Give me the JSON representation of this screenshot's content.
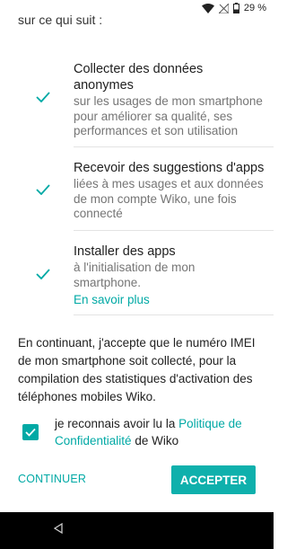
{
  "status_bar": {
    "battery_percent": "29 %",
    "icons": [
      "wifi-icon",
      "no-signal-icon",
      "battery-icon"
    ]
  },
  "intro": "sur ce qui suit :",
  "features": [
    {
      "title": "Collecter des données anonymes",
      "description": "sur les usages de mon smartphone pour améliorer sa qualité, ses performances et son utilisation",
      "checked": true
    },
    {
      "title": "Recevoir des suggestions d'apps",
      "description": "liées à mes usages et aux données de mon compte Wiko, une fois connecté",
      "checked": true
    },
    {
      "title": "Installer des apps",
      "description": "à l'initialisation de mon smartphone.",
      "link": "En savoir plus",
      "checked": true
    }
  ],
  "imei_notice": "En continuant, j'accepte que le numéro IMEI de mon smartphone soit collecté, pour la compilation des statistiques d'activation des téléphones mobiles Wiko.",
  "consent": {
    "checked": true,
    "text_before": "je reconnais avoir lu la ",
    "link_text": "Politique de Confidentialité",
    "text_after": " de Wiko"
  },
  "buttons": {
    "continue": "CONTINUER",
    "accept": "ACCEPTER"
  },
  "colors": {
    "accent": "#00A9A5",
    "button_bg": "#0FB0AC",
    "nav_bg": "#000000"
  }
}
